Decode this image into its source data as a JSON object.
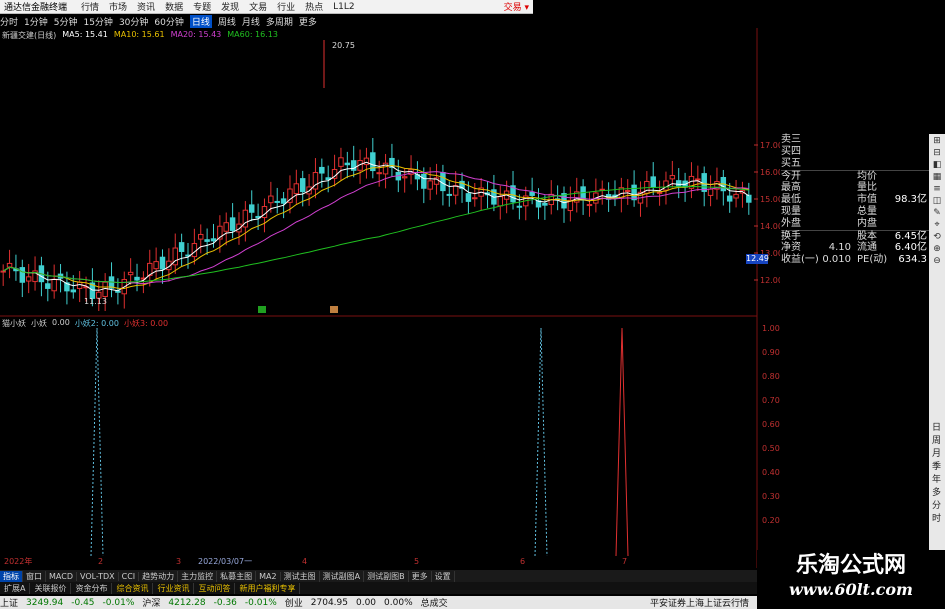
{
  "menu": {
    "title": "通达信金融终端",
    "items": [
      "行情",
      "市场",
      "资讯",
      "数据",
      "专题",
      "发现",
      "文易",
      "行业",
      "热点",
      "L1L2"
    ],
    "trade": "交易 ▾"
  },
  "toolbar": {
    "items": [
      "分时",
      "1分钟",
      "5分钟",
      "15分钟",
      "30分钟",
      "60分钟",
      "日线",
      "周线",
      "月线",
      "多周期",
      "更多"
    ],
    "active_index": 6
  },
  "stock": {
    "name": "新疆交建(日线)",
    "ma": [
      "MA5: 15.41",
      "MA10: 15.61",
      "MA20: 15.43",
      "MA60: 16.13"
    ]
  },
  "price_labels": {
    "high": "20.75",
    "low": "11.13",
    "last": "12.49"
  },
  "y_axis_main": [
    "17.00",
    "16.00",
    "15.00",
    "14.00",
    "13.00",
    "12.00"
  ],
  "y_axis_ind": [
    "1.00",
    "0.90",
    "0.80",
    "0.70",
    "0.60",
    "0.50",
    "0.40",
    "0.30",
    "0.20"
  ],
  "x_axis": [
    "2022年",
    "2",
    "3",
    "2022/03/07一",
    "4",
    "5",
    "6",
    "7"
  ],
  "quote": {
    "rows": [
      {
        "k": "卖三",
        "v": "",
        "k2": "",
        "v2": ""
      },
      {
        "k": "买四",
        "v": "",
        "k2": "",
        "v2": ""
      },
      {
        "k": "买五",
        "v": "",
        "k2": "",
        "v2": ""
      },
      {
        "k": "今开",
        "v": "",
        "k2": "均价",
        "v2": ""
      },
      {
        "k": "最高",
        "v": "",
        "k2": "量比",
        "v2": ""
      },
      {
        "k": "最低",
        "v": "",
        "k2": "市值",
        "v2": "98.3亿"
      },
      {
        "k": "现量",
        "v": "",
        "k2": "总量",
        "v2": ""
      },
      {
        "k": "外盘",
        "v": "",
        "k2": "内盘",
        "v2": ""
      },
      {
        "k": "换手",
        "v": "",
        "k2": "股本",
        "v2": "6.45亿"
      },
      {
        "k": "净资",
        "v": "4.10",
        "k2": "流通",
        "v2": "6.40亿"
      },
      {
        "k": "收益(一)",
        "v": "0.010",
        "k2": "PE(动)",
        "v2": "634.3"
      }
    ]
  },
  "indicator": {
    "legend": [
      "猫小妖",
      "小妖",
      "0.00",
      "小妖2: 0.00",
      "小妖3: 0.00"
    ]
  },
  "tabs": {
    "row1": [
      "指标",
      "窗口",
      "MACD",
      "VOL-TDX",
      "CCI",
      "趋势动力",
      "主力监控",
      "私募主图",
      "MA2",
      "测试主图",
      "测试副图A",
      "测试副图B",
      "更多",
      "设置"
    ],
    "row1_selected": 0,
    "row2": [
      "扩展A",
      "关联报价",
      "资金分布",
      "综合资讯",
      "行业资讯",
      "互动问答",
      "新用户福利专享"
    ]
  },
  "status": {
    "sh_label": "上证",
    "sh": "3249.94",
    "sh_chg": "-0.45",
    "sh_pct": "-0.01%",
    "sz_label": "沪深",
    "sz": "4212.28",
    "sz_chg": "-0.36",
    "sz_pct": "-0.01%",
    "cy_label": "创业",
    "cy": "2704.95",
    "cy_chg": "0.00",
    "cy_pct": "0.00%",
    "amount_label": "总成交",
    "broker": "平安证券上海上证云行情"
  },
  "periods": [
    "日",
    "周",
    "月",
    "季",
    "年",
    "多",
    "分",
    "时"
  ],
  "watermark": {
    "cn": "乐淘公式网",
    "url": "www.60lt.com"
  },
  "chart_data": {
    "type": "candlestick",
    "title": "新疆交建(日线)",
    "series": [
      {
        "name": "MA5",
        "color": "#ffffff"
      },
      {
        "name": "MA10",
        "color": "#e8c000"
      },
      {
        "name": "MA20",
        "color": "#d040d0"
      },
      {
        "name": "MA60",
        "color": "#20c020"
      }
    ],
    "ylim_main": [
      11.0,
      17.5
    ],
    "high": 20.75,
    "low": 11.13,
    "indicator_ylim": [
      0,
      1.0
    ],
    "indicator_spikes": [
      {
        "name": "小妖",
        "color": "#60c0e0",
        "value": 1.0
      },
      {
        "name": "小妖",
        "color": "#60c0e0",
        "value": 1.0
      },
      {
        "name": "小妖3",
        "color": "#e03030",
        "value": 1.0
      }
    ]
  }
}
